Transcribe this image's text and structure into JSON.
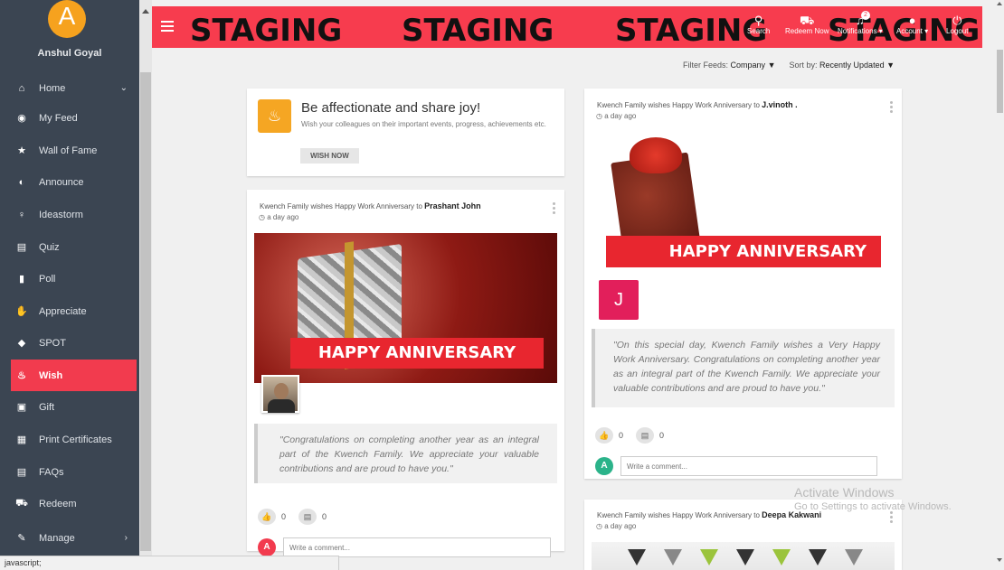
{
  "user": {
    "initial": "A",
    "name": "Anshul Goyal"
  },
  "sidebar": {
    "items": [
      {
        "label": "Home",
        "icon": "home-icon",
        "glyph": "⌂"
      },
      {
        "label": "My Feed",
        "icon": "rss-icon",
        "glyph": "◉"
      },
      {
        "label": "Wall of Fame",
        "icon": "star-icon",
        "glyph": "★"
      },
      {
        "label": "Announce",
        "icon": "announce-icon",
        "glyph": "◐"
      },
      {
        "label": "Ideastorm",
        "icon": "bulb-icon",
        "glyph": "♀"
      },
      {
        "label": "Quiz",
        "icon": "quiz-icon",
        "glyph": "▤"
      },
      {
        "label": "Poll",
        "icon": "poll-icon",
        "glyph": "▮"
      },
      {
        "label": "Appreciate",
        "icon": "thumbs-up-icon",
        "glyph": "✋"
      },
      {
        "label": "SPOT",
        "icon": "shield-icon",
        "glyph": "◆"
      },
      {
        "label": "Wish",
        "icon": "cake-icon",
        "glyph": "♨"
      },
      {
        "label": "Gift",
        "icon": "gift-icon",
        "glyph": "▣"
      },
      {
        "label": "Print Certificates",
        "icon": "printer-icon",
        "glyph": "▦"
      },
      {
        "label": "FAQs",
        "icon": "faq-icon",
        "glyph": "▤"
      },
      {
        "label": "Redeem",
        "icon": "cart-icon",
        "glyph": "⛟"
      },
      {
        "label": "Manage",
        "icon": "pencil-icon",
        "glyph": "✎"
      }
    ],
    "active": "Wish"
  },
  "header": {
    "watermark": [
      "STAGING",
      "STAGING",
      "STAGING",
      "STAGING"
    ],
    "search": "Search",
    "redeem": "Redeem Now",
    "notifications": "Notifications",
    "notification_count": "2",
    "account": "Account",
    "logout": "Logout"
  },
  "filters": {
    "feed_label": "Filter Feeds:",
    "feed_value": "Company",
    "sort_label": "Sort by:",
    "sort_value": "Recently Updated"
  },
  "wish_card": {
    "title": "Be affectionate and share joy!",
    "description": "Wish your colleagues on their important events, progress, achievements etc.",
    "button": "WISH NOW"
  },
  "posts": [
    {
      "prefix": "Kwench Family wishes Happy Work Anniversary to",
      "name": "Prashant John",
      "time": "a day ago",
      "banner_text": "HAPPY ANNIVERSARY",
      "message": "\"Congratulations on completing another year as an integral part of the Kwench Family. We appreciate your valuable contributions and are proud to have you.\"",
      "likes": "0",
      "comments": "0",
      "comment_placeholder": "Write a comment...",
      "commenter_initial": "A"
    },
    {
      "prefix": "Kwench Family wishes Happy Work Anniversary to",
      "name": "J.vinoth .",
      "time": "a day ago",
      "banner_text": "HAPPY ANNIVERSARY",
      "avatar_initial": "J",
      "message": "\"On this special day, Kwench Family wishes a Very Happy Work Anniversary. Congratulations on completing another year as an integral part of the Kwench Family. We appreciate your valuable contributions and are proud to have you.\"",
      "likes": "0",
      "comments": "0",
      "comment_placeholder": "Write a comment...",
      "commenter_initial": "A"
    },
    {
      "prefix": "Kwench Family wishes Happy Work Anniversary to",
      "name": "Deepa Kakwani",
      "time": "a day ago"
    }
  ],
  "status_bar": "javascript;",
  "os_overlay": {
    "line1": "Activate Windows",
    "line2": "Go to Settings to activate Windows."
  },
  "colors": {
    "brand": "#f73c4e",
    "sidebar": "#3b4552",
    "active_nav": "#f23b4e",
    "avatar": "#f6a21e",
    "j_avatar": "#e21f5b",
    "commenter": "#2bb38a"
  }
}
